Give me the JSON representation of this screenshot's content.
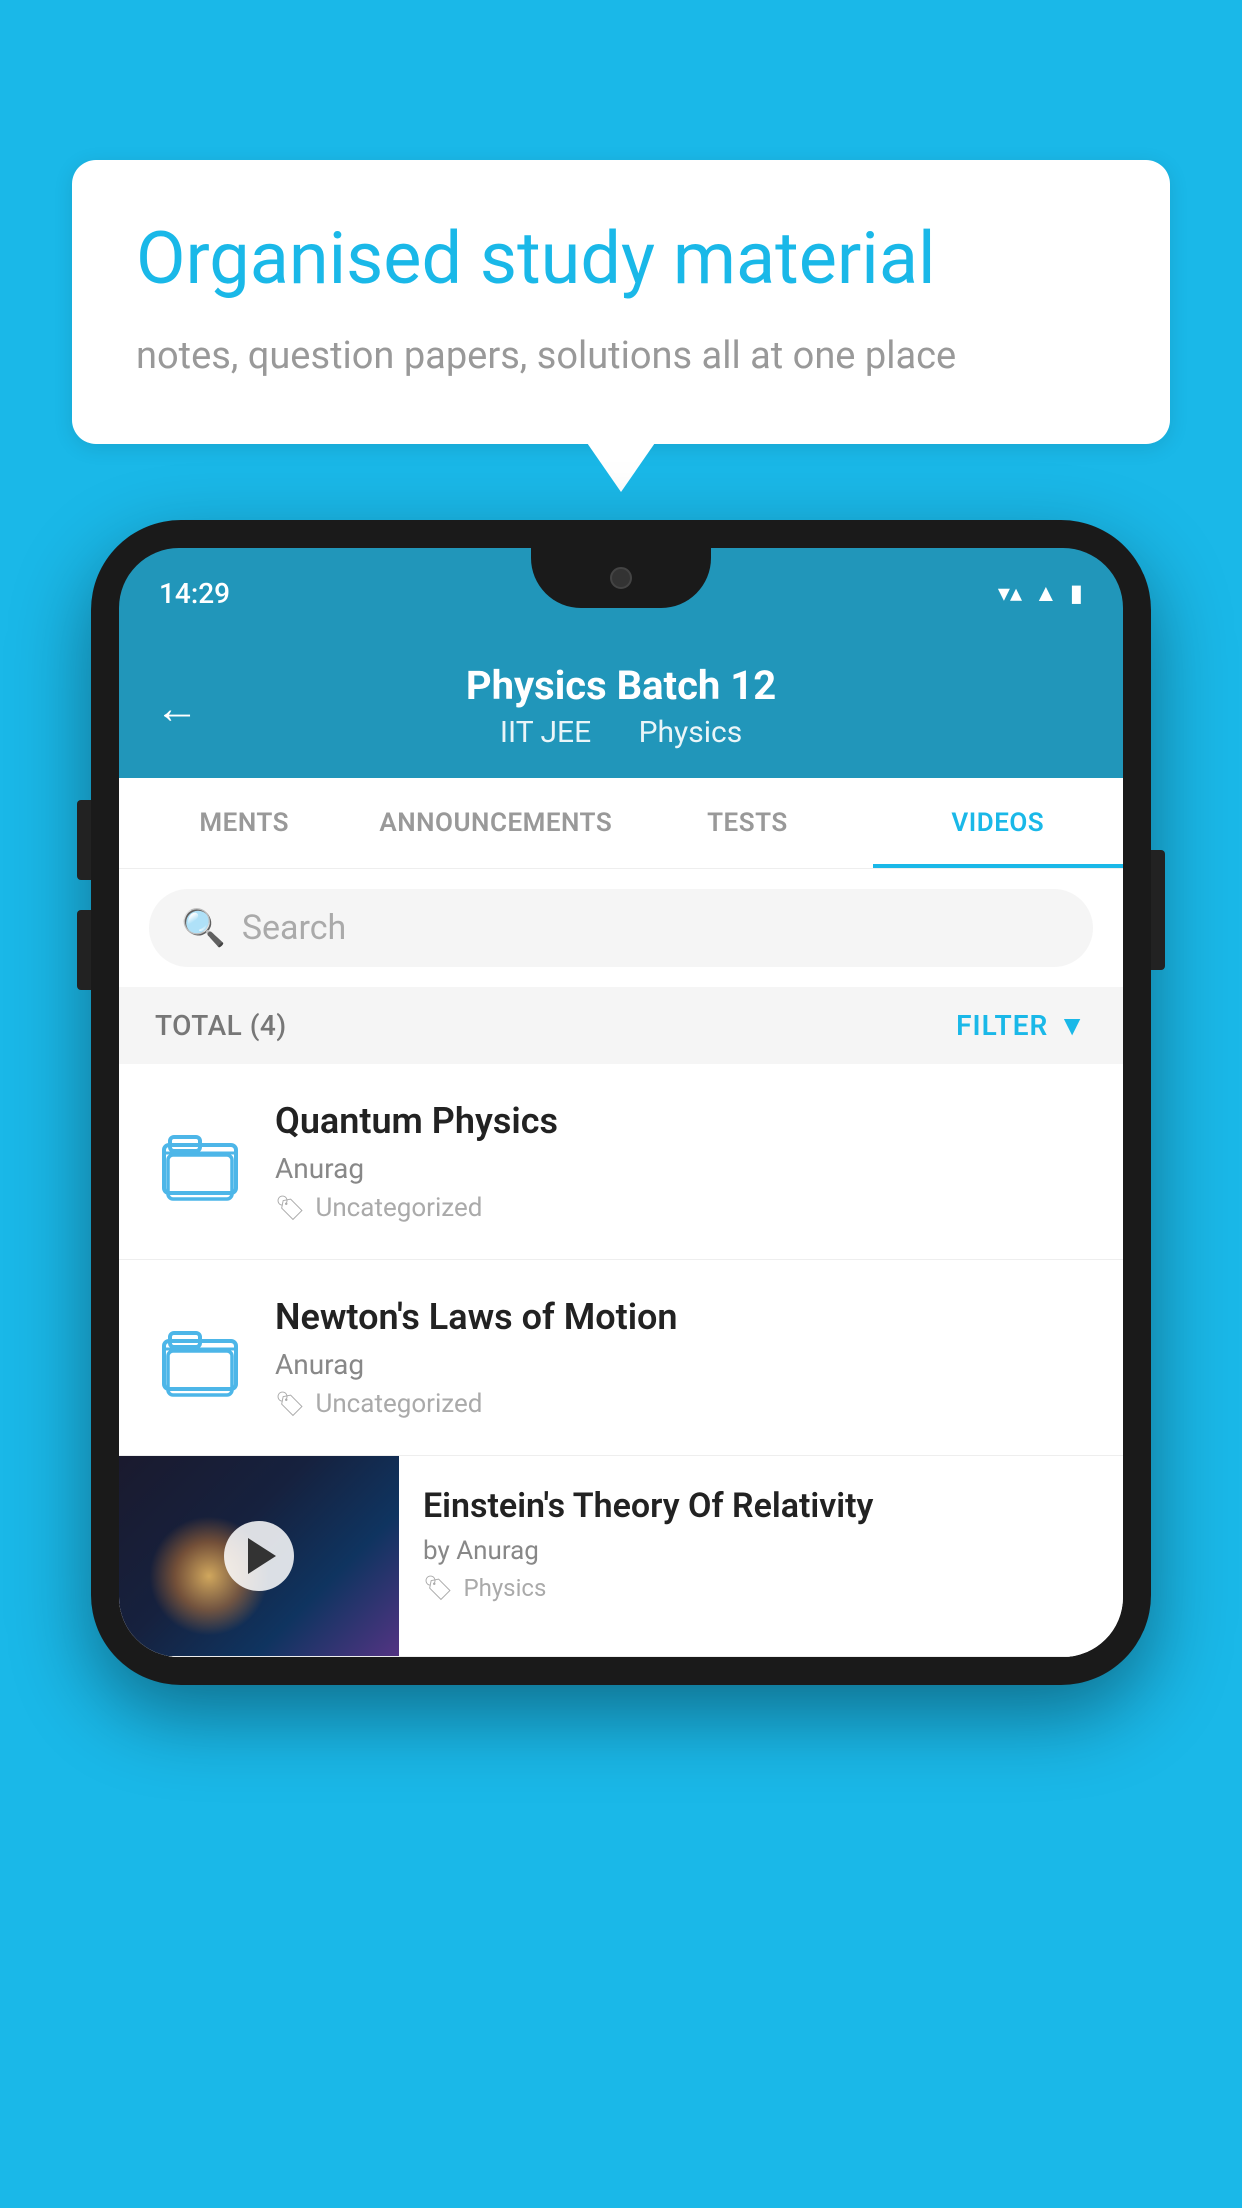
{
  "background_color": "#1ab8e8",
  "speech_bubble": {
    "heading": "Organised study material",
    "subtext": "notes, question papers, solutions all at one place"
  },
  "status_bar": {
    "time": "14:29",
    "icons": [
      "wifi",
      "signal",
      "battery"
    ]
  },
  "app_header": {
    "back_label": "←",
    "title": "Physics Batch 12",
    "subtitle_part1": "IIT JEE",
    "subtitle_part2": "Physics"
  },
  "tabs": [
    {
      "label": "MENTS",
      "active": false
    },
    {
      "label": "ANNOUNCEMENTS",
      "active": false
    },
    {
      "label": "TESTS",
      "active": false
    },
    {
      "label": "VIDEOS",
      "active": true
    }
  ],
  "search": {
    "placeholder": "Search"
  },
  "filter_bar": {
    "total_label": "TOTAL (4)",
    "filter_label": "FILTER"
  },
  "list_items": [
    {
      "title": "Quantum Physics",
      "author": "Anurag",
      "tag": "Uncategorized",
      "type": "folder"
    },
    {
      "title": "Newton's Laws of Motion",
      "author": "Anurag",
      "tag": "Uncategorized",
      "type": "folder"
    },
    {
      "title": "Einstein's Theory Of Relativity",
      "author": "by Anurag",
      "tag": "Physics",
      "type": "video"
    }
  ]
}
